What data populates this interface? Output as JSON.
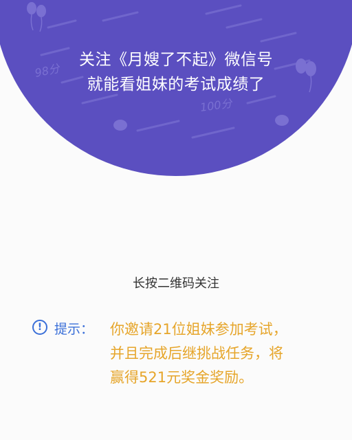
{
  "hero": {
    "line1": "关注《月嫂了不起》微信号",
    "line2": "就能看姐妹的考试成绩了",
    "bg_color": "#5b4fc0",
    "score_left": "98分",
    "score_right": "100分"
  },
  "qr": {
    "hint": "长按二维码关注"
  },
  "tip": {
    "icon": "exclamation-circle-icon",
    "label": "提示：",
    "lines": [
      "你邀请21位姐妹参加考试，",
      "并且完成后继挑战任务，将",
      "赢得521元奖金奖励。"
    ],
    "label_color": "#3a6fd8",
    "text_color": "#e6a52a"
  }
}
